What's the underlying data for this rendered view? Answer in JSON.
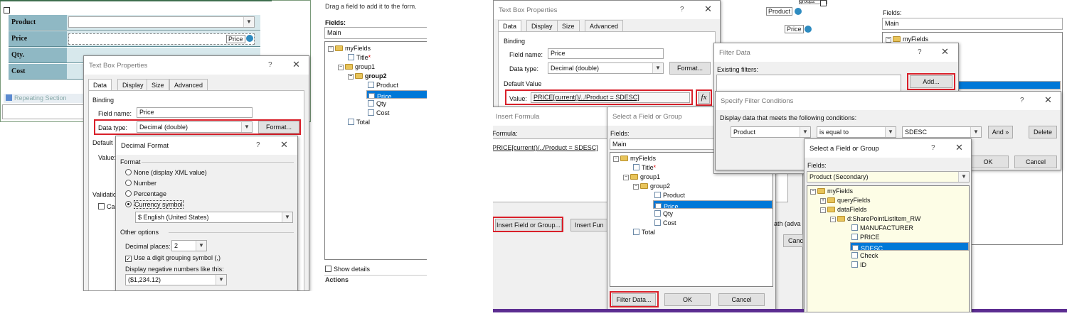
{
  "left": {
    "form": {
      "rows": [
        {
          "label": "Product"
        },
        {
          "label": "Price",
          "control": "Price"
        },
        {
          "label": "Qty."
        },
        {
          "label": "Cost"
        }
      ],
      "repeating_section": "Repeating Section"
    },
    "task_pane": {
      "hint": "Drag a field to add it to the form.",
      "fields_label": "Fields:",
      "source": "Main",
      "tree": [
        "myFields",
        "Title",
        "group1",
        "group2",
        "Product",
        "Price",
        "Qty",
        "Cost",
        "Total"
      ],
      "show_details": "Show details",
      "actions": "Actions"
    },
    "textbox_dialog": {
      "title": "Text Box Properties",
      "help": "?",
      "close": "✕",
      "tabs": [
        "Data",
        "Display",
        "Size",
        "Advanced"
      ],
      "binding": "Binding",
      "field_name_label": "Field name:",
      "field_name": "Price",
      "data_type_label": "Data type:",
      "data_type": "Decimal (double)",
      "format_button": "Format...",
      "default_partial": "Default",
      "value_partial": "Value:",
      "validation_partial": "Validatio",
      "cannot_partial": "Can"
    },
    "decimal_dialog": {
      "title": "Decimal Format",
      "help": "?",
      "close": "✕",
      "format_group": "Format",
      "options": [
        "None (display XML value)",
        "Number",
        "Percentage",
        "Currency symbol"
      ],
      "selected_option": 3,
      "currency": "$ English (United States)",
      "other_group": "Other options",
      "decimal_places_label": "Decimal places:",
      "decimal_places": "2",
      "grouping": "Use a digit grouping symbol (,)",
      "negative_label": "Display negative numbers like this:",
      "negative_value": "($1,234.12)"
    }
  },
  "right": {
    "form_snippets": {
      "product": "Product",
      "price": "Price",
      "group2": "group2"
    },
    "task_pane": {
      "fields_label": "Fields:",
      "source": "Main",
      "tree": [
        "myFields",
        "Title",
        "group1",
        "group2",
        "Product",
        "Price",
        "Qty",
        "Cost",
        "Total"
      ],
      "partial_text_1": "ct",
      "path_partial": "ath (adva",
      "cancel_partial": "Canc"
    },
    "textbox_dialog": {
      "title": "Text Box Properties",
      "help": "?",
      "close": "✕",
      "tabs": [
        "Data",
        "Display",
        "Size",
        "Advanced"
      ],
      "binding": "Binding",
      "field_name_label": "Field name:",
      "field_name": "Price",
      "data_type_label": "Data type:",
      "data_type": "Decimal (double)",
      "format_button": "Format...",
      "default_value_label": "Default Value",
      "value_label": "Value:",
      "value_formula": "PRICE[current()/../Product = SDESC]",
      "fx": "fx"
    },
    "insert_formula": {
      "title": "Insert Formula",
      "formula_label": "Formula:",
      "formula": "PRICE[current()/../Product = SDESC]",
      "insert_field_button": "Insert Field or Group...",
      "insert_function_button": "Insert Fun"
    },
    "select_field_main": {
      "title": "Select a Field or Group",
      "help": "?",
      "close": "✕",
      "fields_label": "Fields:",
      "source": "Main",
      "tree": [
        "myFields",
        "Title",
        "group1",
        "group2",
        "Product",
        "Price",
        "Qty",
        "Cost",
        "Total"
      ],
      "filter_button": "Filter Data...",
      "ok": "OK",
      "cancel": "Cancel"
    },
    "filter_data": {
      "title": "Filter Data",
      "help": "?",
      "close": "✕",
      "existing_label": "Existing filters:",
      "add_button": "Add..."
    },
    "filter_conditions": {
      "title": "Specify Filter Conditions",
      "help": "?",
      "close": "✕",
      "prompt": "Display data that meets the following conditions:",
      "field": "Product",
      "operator": "is equal to",
      "value": "SDESC",
      "and_button": "And »",
      "delete_button": "Delete",
      "ok": "OK",
      "cancel": "Cancel"
    },
    "select_field_secondary": {
      "title": "Select a Field or Group",
      "help": "?",
      "close": "✕",
      "fields_label": "Fields:",
      "source": "Product (Secondary)",
      "tree": [
        "myFields",
        "queryFields",
        "dataFields",
        "d:SharePointListItem_RW",
        "MANUFACTURER",
        "PRICE",
        "SDESC",
        "Check",
        "ID"
      ]
    }
  },
  "colors": {
    "highlight_red": "#d9202a",
    "selection_blue": "#0078d7",
    "form_label": "#8fb8c4",
    "secondary_bg": "#fdfde6"
  }
}
